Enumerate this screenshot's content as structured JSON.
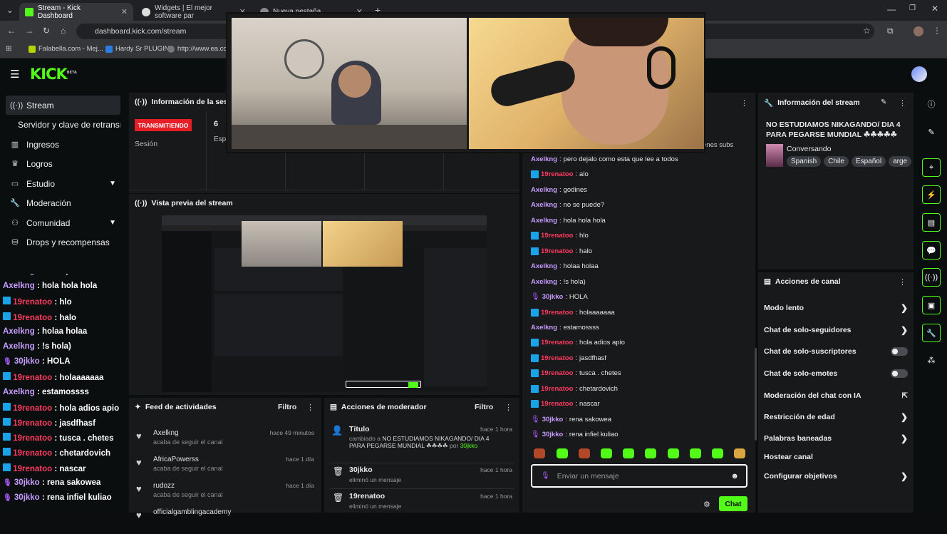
{
  "browser": {
    "tabs": [
      {
        "label": "Stream - Kick Dashboard",
        "active": true
      },
      {
        "label": "Widgets | El mejor software par",
        "active": false
      },
      {
        "label": "Nueva pestaña",
        "active": false
      }
    ],
    "url": "dashboard.kick.com/stream",
    "bookmarks": [
      "Falabella.com - Mej...",
      "Hardy Sr PLUGIN",
      "http://www.ea.co"
    ]
  },
  "brand": {
    "logo": "KICK",
    "beta": "BETA",
    "accent": "#53fc18"
  },
  "sidebar": {
    "items": [
      {
        "label": "Stream",
        "icon": "broadcast-icon",
        "active": true
      },
      {
        "label": "Servidor y clave de retransmisión",
        "icon": "",
        "active": false
      },
      {
        "label": "Ingresos",
        "icon": "chart-icon",
        "active": false
      },
      {
        "label": "Logros",
        "icon": "trophy-icon",
        "active": false
      },
      {
        "label": "Estudio",
        "icon": "studio-icon",
        "active": false,
        "expandable": true
      },
      {
        "label": "Moderación",
        "icon": "wrench-icon",
        "active": false
      },
      {
        "label": "Comunidad",
        "icon": "community-icon",
        "active": false,
        "expandable": true
      },
      {
        "label": "Drops y recompensas",
        "icon": "drops-icon",
        "active": false
      }
    ]
  },
  "left_chat_overlay": [
    {
      "user": "Axelkng",
      "msg": "no se puede?",
      "badge": "none",
      "color": "A"
    },
    {
      "user": "Axelkng",
      "msg": "hola hola hola",
      "badge": "none",
      "color": "A"
    },
    {
      "user": "19renatoo",
      "msg": "hlo",
      "badge": "bot",
      "color": "R"
    },
    {
      "user": "19renatoo",
      "msg": "halo",
      "badge": "bot",
      "color": "R"
    },
    {
      "user": "Axelkng",
      "msg": "holaa holaa",
      "badge": "none",
      "color": "A"
    },
    {
      "user": "Axelkng",
      "msg": "!s hola)",
      "badge": "none",
      "color": "A"
    },
    {
      "user": "30jkko",
      "msg": "HOLA",
      "badge": "mic",
      "color": "J"
    },
    {
      "user": "19renatoo",
      "msg": "holaaaaaaa",
      "badge": "bot",
      "color": "R"
    },
    {
      "user": "Axelkng",
      "msg": "estamossss",
      "badge": "none",
      "color": "A"
    },
    {
      "user": "19renatoo",
      "msg": "hola adios apio",
      "badge": "bot",
      "color": "R"
    },
    {
      "user": "19renatoo",
      "msg": "jasdfhasf",
      "badge": "bot",
      "color": "R"
    },
    {
      "user": "19renatoo",
      "msg": "tusca . chetes",
      "badge": "bot",
      "color": "R"
    },
    {
      "user": "19renatoo",
      "msg": "chetardovich",
      "badge": "bot",
      "color": "R"
    },
    {
      "user": "19renatoo",
      "msg": "nascar",
      "badge": "bot",
      "color": "R"
    },
    {
      "user": "30jkko",
      "msg": "rena sakowea",
      "badge": "mic",
      "color": "J"
    },
    {
      "user": "30jkko",
      "msg": "rena infiel kuliao",
      "badge": "mic",
      "color": "J"
    }
  ],
  "session": {
    "title": "Información de la sesión",
    "status_badge": "TRANSMITIENDO",
    "session_label": "Sesión",
    "viewers_value": "6",
    "viewers_label": "Esp",
    "subs_label": "enes subs"
  },
  "preview": {
    "title": "Vista previa del stream"
  },
  "activity_feed": {
    "title": "Feed de actividades",
    "filter_label": "Filtro",
    "items": [
      {
        "name": "Axelkng",
        "action": "acaba de seguir el canal",
        "time": "hace 49 minutos"
      },
      {
        "name": "AfricaPowerss",
        "action": "acaba de seguir el canal",
        "time": "hace 1 día"
      },
      {
        "name": "rudozz",
        "action": "acaba de seguir el canal",
        "time": "hace 1 día"
      },
      {
        "name": "officialgamblingacademy",
        "action": "",
        "time": ""
      }
    ]
  },
  "mod_actions": {
    "title": "Acciones de moderador",
    "filter_label": "Filtro",
    "items": [
      {
        "title": "Título",
        "desc_pre": "cambiado a",
        "desc_bold": "NO ESTUDIAMOS NIKAGANDO/ DIA 4 PARA PEGARSE MUNDIAL ☘☘☘☘",
        "desc_by": "por",
        "by_user": "30jkko",
        "time": "hace 1 hora"
      },
      {
        "title": "30jkko",
        "desc_pre": "eliminó un mensaje",
        "time": "hace 1 hora"
      },
      {
        "title": "19renatoo",
        "desc_pre": "eliminó un mensaje",
        "time": "hace 1 hora"
      }
    ]
  },
  "chat": {
    "messages": [
      {
        "user": "Axelkng",
        "msg": "pero dejalo como esta que lee a todos",
        "badge": "none",
        "color": "A"
      },
      {
        "user": "19renatoo",
        "msg": "alo",
        "badge": "bot",
        "color": "R"
      },
      {
        "user": "Axelkng",
        "msg": "godines",
        "badge": "none",
        "color": "A"
      },
      {
        "user": "Axelkng",
        "msg": "no se puede?",
        "badge": "none",
        "color": "A"
      },
      {
        "user": "Axelkng",
        "msg": "hola hola hola",
        "badge": "none",
        "color": "A"
      },
      {
        "user": "19renatoo",
        "msg": "hlo",
        "badge": "bot",
        "color": "R"
      },
      {
        "user": "19renatoo",
        "msg": "halo",
        "badge": "bot",
        "color": "R"
      },
      {
        "user": "Axelkng",
        "msg": "holaa holaa",
        "badge": "none",
        "color": "A"
      },
      {
        "user": "Axelkng",
        "msg": "!s hola)",
        "badge": "none",
        "color": "A"
      },
      {
        "user": "30jkko",
        "msg": "HOLA",
        "badge": "mic",
        "color": "J"
      },
      {
        "user": "19renatoo",
        "msg": "holaaaaaaa",
        "badge": "bot",
        "color": "R"
      },
      {
        "user": "Axelkng",
        "msg": "estamossss",
        "badge": "none",
        "color": "A"
      },
      {
        "user": "19renatoo",
        "msg": "hola adios apio",
        "badge": "bot",
        "color": "R"
      },
      {
        "user": "19renatoo",
        "msg": "jasdfhasf",
        "badge": "bot",
        "color": "R"
      },
      {
        "user": "19renatoo",
        "msg": "tusca . chetes",
        "badge": "bot",
        "color": "R"
      },
      {
        "user": "19renatoo",
        "msg": "chetardovich",
        "badge": "bot",
        "color": "R"
      },
      {
        "user": "19renatoo",
        "msg": "nascar",
        "badge": "bot",
        "color": "R"
      },
      {
        "user": "30jkko",
        "msg": "rena sakowea",
        "badge": "mic",
        "color": "J"
      },
      {
        "user": "30jkko",
        "msg": "rena infiel kuliao",
        "badge": "mic",
        "color": "J"
      }
    ],
    "input_placeholder": "Enviar un mensaje",
    "send_label": "Chat"
  },
  "stream_info": {
    "title": "Información del stream",
    "stream_title": "NO ESTUDIAMOS NIKAGANDO/ DIA 4 PARA PEGARSE MUNDIAL ☘☘☘☘☘",
    "category": "Conversando",
    "tags": [
      "Spanish",
      "Chile",
      "Español",
      "arge"
    ]
  },
  "channel_actions": {
    "title": "Acciones de canal",
    "items": [
      {
        "label": "Modo lento",
        "control": "arrow"
      },
      {
        "label": "Chat de solo-seguidores",
        "control": "arrow"
      },
      {
        "label": "Chat de solo-suscriptores",
        "control": "toggle"
      },
      {
        "label": "Chat de solo-emotes",
        "control": "toggle"
      },
      {
        "label": "Moderación del chat con IA",
        "control": "external"
      },
      {
        "label": "Restricción de edad",
        "control": "arrow"
      },
      {
        "label": "Palabras baneadas",
        "control": "arrow"
      },
      {
        "label": "Hostear canal",
        "control": "none"
      },
      {
        "label": "Configurar objetivos",
        "control": "arrow"
      }
    ]
  }
}
